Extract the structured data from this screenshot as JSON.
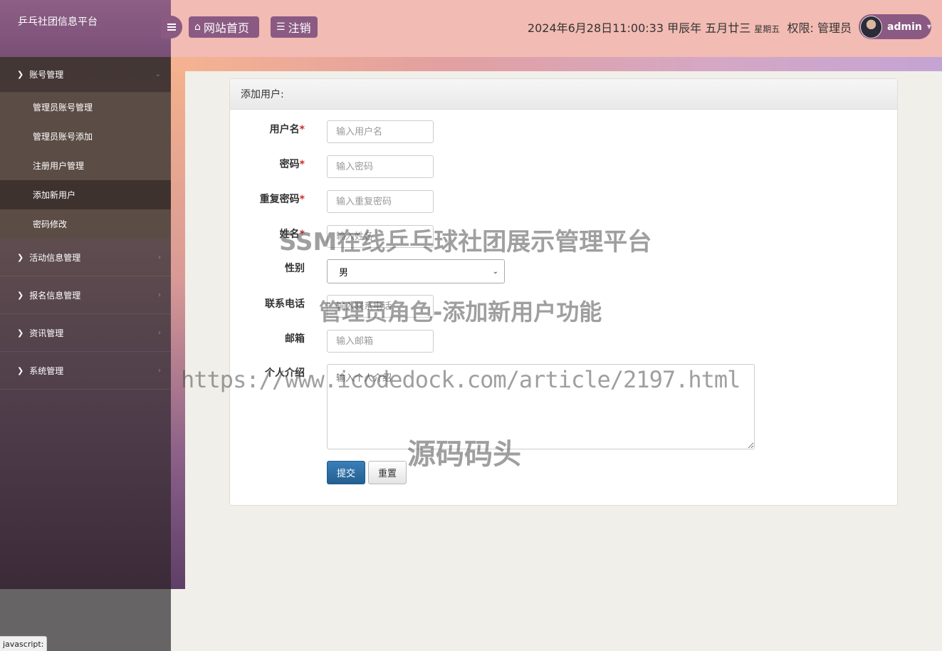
{
  "app": {
    "title": "乒乓社团信息平台"
  },
  "header": {
    "home_label": "网站首页",
    "logout_label": "注销",
    "datetime": "2024年6月28日11:00:33 甲辰年 五月廿三",
    "weekday": "星期五",
    "role_prefix": "权限:",
    "role": "管理员",
    "username": "admin"
  },
  "sidebar": {
    "groups": [
      {
        "label": "账号管理",
        "open": true,
        "items": [
          {
            "label": "管理员账号管理"
          },
          {
            "label": "管理员账号添加"
          },
          {
            "label": "注册用户管理"
          },
          {
            "label": "添加新用户",
            "active": true
          },
          {
            "label": "密码修改"
          }
        ]
      },
      {
        "label": "活动信息管理"
      },
      {
        "label": "报名信息管理"
      },
      {
        "label": "资讯管理"
      },
      {
        "label": "系统管理"
      }
    ]
  },
  "form": {
    "title": "添加用户:",
    "fields": [
      {
        "label": "用户名",
        "required": "*",
        "placeholder": "输入用户名"
      },
      {
        "label": "密码",
        "required": "*",
        "placeholder": "输入密码"
      },
      {
        "label": "重复密码",
        "required": "*",
        "placeholder": "输入重复密码"
      },
      {
        "label": "姓名",
        "required": "*",
        "placeholder": "输入姓名"
      },
      {
        "label": "性别",
        "value": "男"
      },
      {
        "label": "联系电话",
        "placeholder": "输入联系电话"
      },
      {
        "label": "邮箱",
        "placeholder": "输入邮箱"
      },
      {
        "label": "个人介绍",
        "placeholder": "输入个人介绍"
      }
    ],
    "submit_label": "提交",
    "reset_label": "重置"
  },
  "watermarks": {
    "line1": "SSM在线乒乓球社团展示管理平台",
    "line2": "管理员角色-添加新用户功能",
    "line3": "https://www.icodedock.com/article/2197.html",
    "line4": "源码码头"
  },
  "status_bar": "javascript:"
}
